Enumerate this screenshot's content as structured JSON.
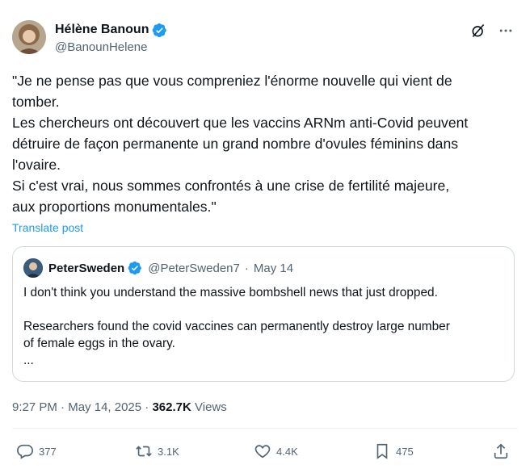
{
  "tweet": {
    "author": {
      "name": "Hélène Banoun",
      "handle": "@BanounHelene"
    },
    "body": [
      "\"Je ne pense pas que vous compreniez l'énorme nouvelle qui vient de",
      "tomber.",
      "Les chercheurs ont découvert que les vaccins ARNm anti-Covid peuvent",
      "détruire de façon permanente un grand nombre d'ovules féminins dans",
      "l'ovaire.",
      "Si c'est vrai, nous sommes confrontés à une crise de fertilité majeure,",
      "aux proportions monumentales.\""
    ],
    "translate_label": "Translate post",
    "quote": {
      "name": "PeterSweden",
      "handle": "@PeterSweden7",
      "separator": "·",
      "date": "May 14",
      "line1": "I don't think you understand the massive bombshell news that just dropped.",
      "line2": "Researchers found the covid vaccines can permanently destroy large number",
      "line3": "of female eggs in the ovary.",
      "line4": "..."
    },
    "meta": {
      "time": "9:27 PM",
      "separator": "·",
      "date": "May 14, 2025",
      "views_count": "362.7K",
      "views_label": "Views"
    },
    "actions": {
      "replies": "377",
      "reposts": "3.1K",
      "likes": "4.4K",
      "bookmarks": "475"
    }
  },
  "colors": {
    "accent": "#1d9bf0",
    "secondary_text": "#536471",
    "border": "#cfd9de"
  },
  "icons": [
    "verified-badge-icon",
    "grok-icon",
    "more-icon",
    "reply-icon",
    "repost-icon",
    "like-icon",
    "bookmark-icon",
    "share-icon"
  ]
}
